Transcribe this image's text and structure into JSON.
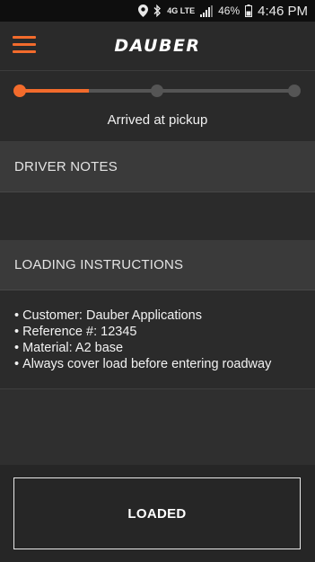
{
  "status_bar": {
    "network": "4G LTE",
    "battery": "46%",
    "time": "4:46 PM",
    "icons": [
      "location-icon",
      "bluetooth-icon",
      "network-icon",
      "signal-icon",
      "battery-icon"
    ]
  },
  "app_bar": {
    "logo": "DAUBER",
    "menu_icon": "hamburger-menu-icon"
  },
  "progress": {
    "label": "Arrived at pickup",
    "steps_total": 3,
    "current_step": 1,
    "fill_fraction": 0.25,
    "accent_color": "#f26b2c"
  },
  "driver_notes": {
    "title": "DRIVER NOTES"
  },
  "loading_instructions": {
    "title": "LOADING INSTRUCTIONS",
    "items": [
      "Customer: Dauber Applications",
      "Reference #: 12345",
      "Material: A2 base",
      "Always cover load before entering roadway"
    ]
  },
  "footer": {
    "button_label": "LOADED"
  }
}
